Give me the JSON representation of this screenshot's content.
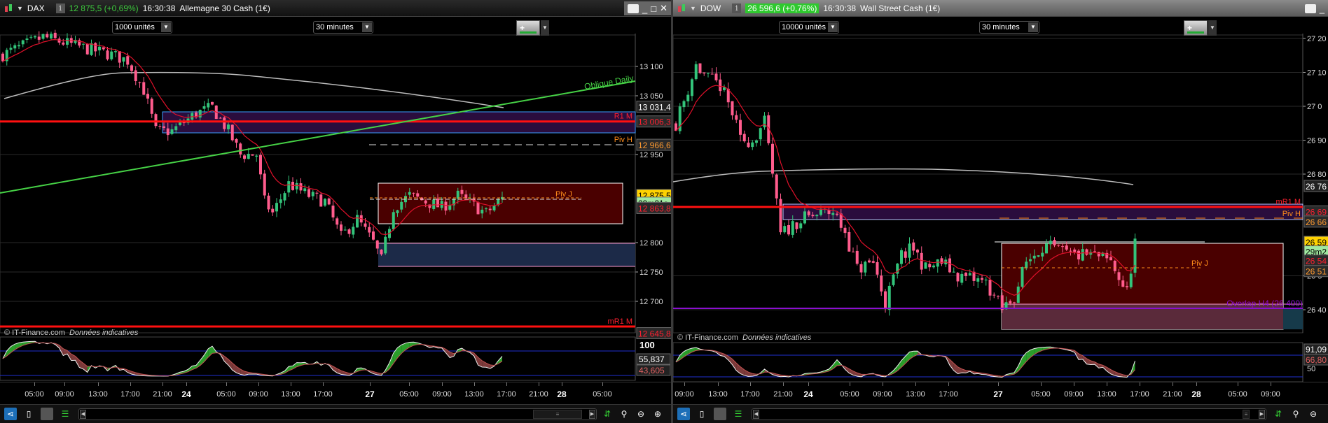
{
  "colors": {
    "up": "#33c47a",
    "down": "#ff5c8d",
    "ma": "#e0102a",
    "ma_long": "#bdbdbd",
    "oblique": "#46d246",
    "pivot": "#ff8c1a",
    "resistance": "#ff1010"
  },
  "left": {
    "symbol": "DAX",
    "price": "12 875,5 (+0,69%)",
    "time": "16:30:38",
    "name": "Allemagne 30 Cash (1€)",
    "units": "1000 unités",
    "timeframe": "30 minutes",
    "copyright": "© IT-Finance.com",
    "copyright_note": "Données indicatives",
    "axis": [
      {
        "v": 13100,
        "t": "13 100"
      },
      {
        "v": 13050,
        "t": "13 050"
      },
      {
        "v": 12950,
        "t": "12 950"
      },
      {
        "v": 12800,
        "t": "12 800"
      },
      {
        "v": 12750,
        "t": "12 750"
      },
      {
        "v": 12700,
        "t": "12 700"
      }
    ],
    "badges": [
      {
        "v": 13031.4,
        "t": "13 031,4",
        "kind": "grey"
      },
      {
        "v": 13006.3,
        "t": "13 006,3",
        "kind": "red"
      },
      {
        "v": 12966.6,
        "t": "12 966,6",
        "kind": "orange"
      },
      {
        "v": 12881,
        "t": "12 875,5",
        "kind": "yellow"
      },
      {
        "v": 12868,
        "t": "29m21s",
        "kind": "green"
      },
      {
        "v": 12859,
        "t": "12 863,8",
        "kind": "red"
      },
      {
        "v": 12645.8,
        "t": "12 645,8",
        "kind": "red"
      }
    ],
    "labels": {
      "r1m": "R1 M",
      "pivh": "Piv H",
      "pivj": "Piv J",
      "mr1m": "mR1 M",
      "oblique": "Oblique Daily"
    },
    "osc": {
      "max": "100",
      "k": "55,837",
      "d": "43,605"
    },
    "times": [
      {
        "t": "05:00"
      },
      {
        "t": "09:00"
      },
      {
        "t": "13:00"
      },
      {
        "t": "17:00"
      },
      {
        "t": "21:00"
      },
      {
        "t": "24",
        "day": true
      },
      {
        "t": "05:00"
      },
      {
        "t": "09:00"
      },
      {
        "t": "13:00"
      },
      {
        "t": "17:00"
      },
      {
        "t": "27",
        "day": true
      },
      {
        "t": "05:00"
      },
      {
        "t": "09:00"
      },
      {
        "t": "13:00"
      },
      {
        "t": "17:00"
      },
      {
        "t": "21:00"
      },
      {
        "t": "28",
        "day": true
      },
      {
        "t": "05:00"
      }
    ],
    "anchors": [
      [
        0,
        13120
      ],
      [
        10,
        13150
      ],
      [
        21,
        13130
      ],
      [
        27,
        13120
      ],
      [
        31,
        13110
      ],
      [
        35,
        13060
      ],
      [
        38,
        12990
      ],
      [
        42,
        12990
      ],
      [
        48,
        13020
      ],
      [
        52,
        13030
      ],
      [
        56,
        12990
      ],
      [
        59,
        12950
      ],
      [
        63,
        12950
      ],
      [
        65,
        12870
      ],
      [
        67,
        12850
      ],
      [
        71,
        12900
      ],
      [
        76,
        12880
      ],
      [
        80,
        12870
      ],
      [
        84,
        12810
      ],
      [
        88,
        12840
      ],
      [
        92,
        12800
      ],
      [
        94,
        12770
      ],
      [
        97,
        12860
      ],
      [
        101,
        12880
      ],
      [
        109,
        12860
      ],
      [
        113,
        12880
      ],
      [
        120,
        12850
      ],
      [
        124,
        12875
      ]
    ]
  },
  "right": {
    "symbol": "DOW",
    "price": "26 596,6 (+0,76%)",
    "time": "16:30:38",
    "name": "Wall Street Cash (1€)",
    "units": "10000 unités",
    "timeframe": "30 minutes",
    "copyright": "© IT-Finance.com",
    "copyright_note": "Données indicatives",
    "axis": [
      {
        "v": 27200,
        "t": "27 20"
      },
      {
        "v": 27100,
        "t": "27 10"
      },
      {
        "v": 27000,
        "t": "27 0"
      },
      {
        "v": 26900,
        "t": "26 90"
      },
      {
        "v": 26800,
        "t": "26 80"
      },
      {
        "v": 26500,
        "t": "26 5"
      },
      {
        "v": 26400,
        "t": "26 40"
      }
    ],
    "badges": [
      {
        "v": 26765,
        "t": "26 76",
        "kind": "grey"
      },
      {
        "v": 26690,
        "t": "26 69",
        "kind": "red"
      },
      {
        "v": 26660,
        "t": "26 66",
        "kind": "orange"
      },
      {
        "v": 26600,
        "t": "26 59",
        "kind": "yellow"
      },
      {
        "v": 26572,
        "t": "29m2",
        "kind": "green"
      },
      {
        "v": 26545,
        "t": "26 54",
        "kind": "red"
      },
      {
        "v": 26514,
        "t": "26 51",
        "kind": "orange"
      }
    ],
    "labels": {
      "mr1m": "mR1 M",
      "pivh": "Piv H",
      "pivj": "Piv J",
      "overlap": "Overlap H4 (26 400)"
    },
    "osc": {
      "k": "91,09",
      "d": "66,80",
      "mid": "50"
    },
    "times": [
      {
        "t": "09:00"
      },
      {
        "t": "13:00"
      },
      {
        "t": "17:00"
      },
      {
        "t": "21:00"
      },
      {
        "t": "24",
        "day": true
      },
      {
        "t": "05:00"
      },
      {
        "t": "09:00"
      },
      {
        "t": "13:00"
      },
      {
        "t": "17:00"
      },
      {
        "t": "27",
        "day": true
      },
      {
        "t": "05:00"
      },
      {
        "t": "09:00"
      },
      {
        "t": "13:00"
      },
      {
        "t": "17:00"
      },
      {
        "t": "21:00"
      },
      {
        "t": "28",
        "day": true
      },
      {
        "t": "05:00"
      },
      {
        "t": "09:00"
      }
    ],
    "anchors": [
      [
        0,
        26950
      ],
      [
        3,
        27050
      ],
      [
        5,
        27120
      ],
      [
        8,
        27080
      ],
      [
        11,
        27060
      ],
      [
        14,
        26980
      ],
      [
        16,
        26900
      ],
      [
        19,
        26900
      ],
      [
        22,
        26950
      ],
      [
        24,
        26800
      ],
      [
        26,
        26620
      ],
      [
        30,
        26660
      ],
      [
        35,
        26680
      ],
      [
        39,
        26690
      ],
      [
        42,
        26630
      ],
      [
        45,
        26520
      ],
      [
        49,
        26540
      ],
      [
        52,
        26420
      ],
      [
        56,
        26560
      ],
      [
        59,
        26580
      ],
      [
        62,
        26520
      ],
      [
        66,
        26540
      ],
      [
        70,
        26500
      ],
      [
        77,
        26480
      ],
      [
        81,
        26400
      ],
      [
        84,
        26440
      ],
      [
        87,
        26540
      ],
      [
        91,
        26590
      ],
      [
        98,
        26560
      ],
      [
        104,
        26560
      ],
      [
        108,
        26540
      ],
      [
        112,
        26450
      ],
      [
        114,
        26600
      ]
    ]
  }
}
